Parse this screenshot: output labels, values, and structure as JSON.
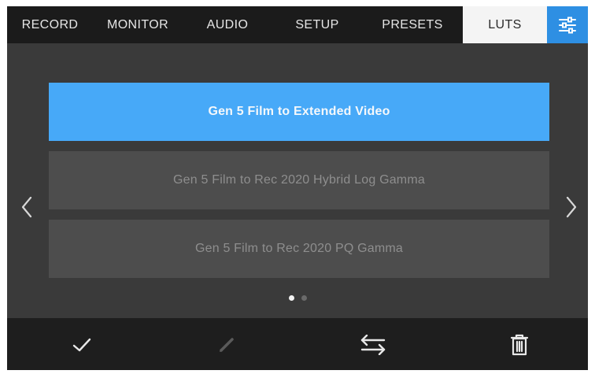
{
  "tabs": [
    {
      "label": "RECORD",
      "active": false
    },
    {
      "label": "MONITOR",
      "active": false
    },
    {
      "label": "AUDIO",
      "active": false
    },
    {
      "label": "SETUP",
      "active": false
    },
    {
      "label": "PRESETS",
      "active": false
    },
    {
      "label": "LUTS",
      "active": true
    }
  ],
  "settings_tab_icon": "sliders-icon",
  "lut_list": {
    "items": [
      {
        "label": "Gen 5 Film to Extended Video",
        "selected": true
      },
      {
        "label": "Gen 5 Film to Rec 2020 Hybrid Log Gamma",
        "selected": false
      },
      {
        "label": "Gen 5 Film to Rec 2020 PQ Gamma",
        "selected": false
      }
    ],
    "prev_icon": "chevron-left-icon",
    "next_icon": "chevron-right-icon"
  },
  "pagination": {
    "pages": 2,
    "current": 1
  },
  "toolbar": {
    "icons": [
      "checkmark-icon",
      "pencil-icon",
      "swap-arrows-icon",
      "trash-icon"
    ],
    "pencil_enabled": false
  },
  "colors": {
    "selected": "#47a9f8",
    "settings_accent": "#2e8fe3",
    "background": "#3a3a3a",
    "bar": "#1b1b1b"
  }
}
